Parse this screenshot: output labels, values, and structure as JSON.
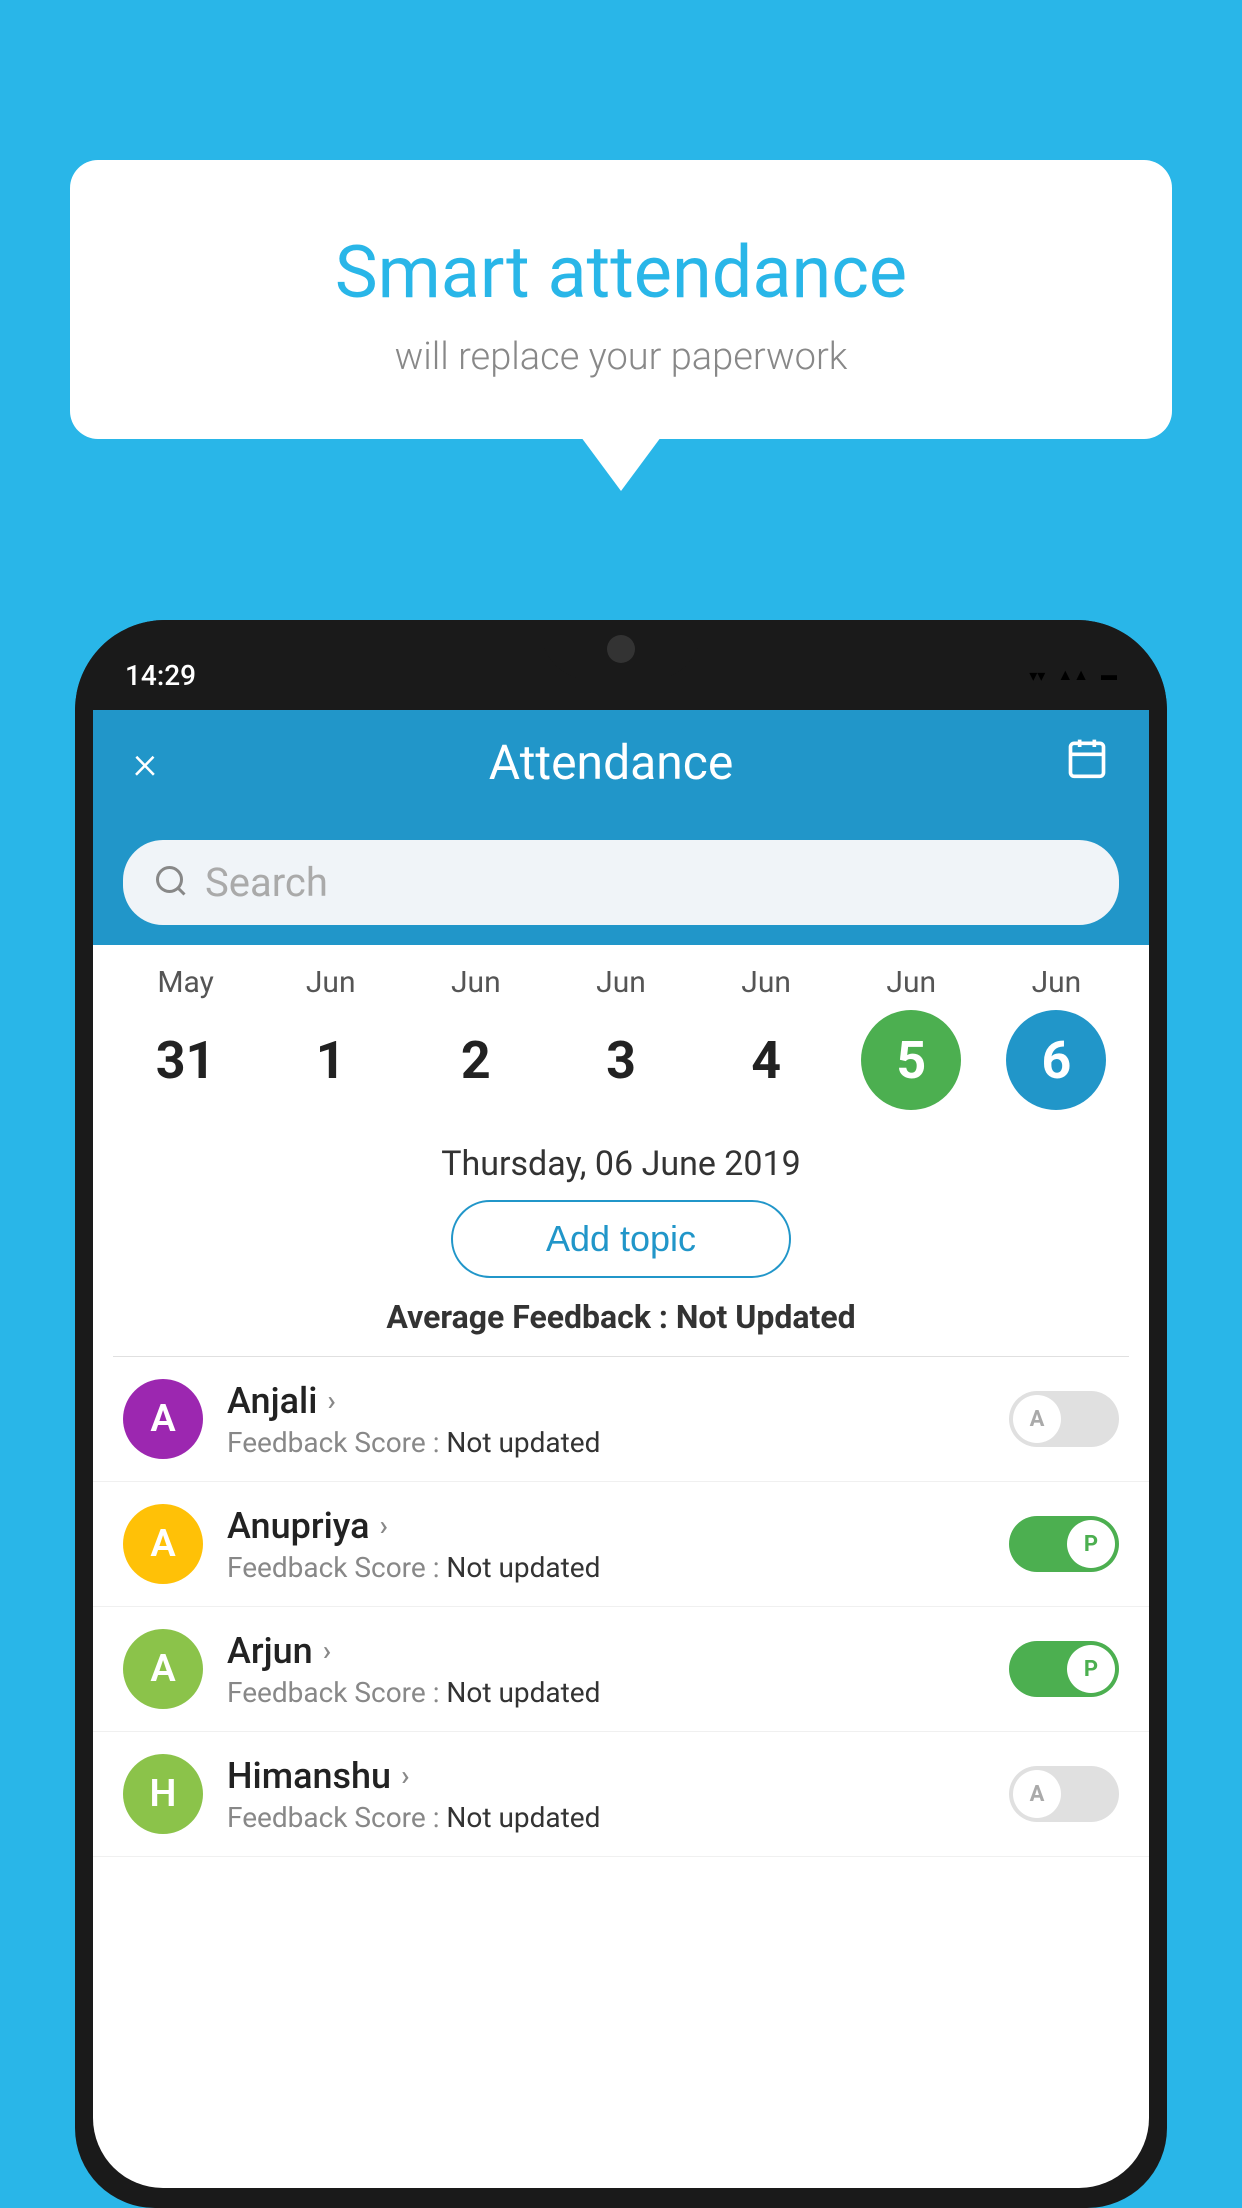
{
  "background_color": "#29B6E8",
  "bubble": {
    "title": "Smart attendance",
    "subtitle": "will replace your paperwork"
  },
  "phone": {
    "status_time": "14:29",
    "header": {
      "title": "Attendance",
      "close_label": "×",
      "calendar_icon": "📅"
    },
    "search": {
      "placeholder": "Search"
    },
    "calendar": {
      "items": [
        {
          "month": "May",
          "day": "31",
          "state": "normal"
        },
        {
          "month": "Jun",
          "day": "1",
          "state": "normal"
        },
        {
          "month": "Jun",
          "day": "2",
          "state": "normal"
        },
        {
          "month": "Jun",
          "day": "3",
          "state": "normal"
        },
        {
          "month": "Jun",
          "day": "4",
          "state": "normal"
        },
        {
          "month": "Jun",
          "day": "5",
          "state": "today"
        },
        {
          "month": "Jun",
          "day": "6",
          "state": "selected"
        }
      ]
    },
    "selected_date": "Thursday, 06 June 2019",
    "add_topic_label": "Add topic",
    "avg_feedback_label": "Average Feedback :",
    "avg_feedback_value": "Not Updated",
    "students": [
      {
        "name": "Anjali",
        "feedback": "Not updated",
        "avatar_letter": "A",
        "avatar_color": "#9C27B0",
        "attendance": "absent"
      },
      {
        "name": "Anupriya",
        "feedback": "Not updated",
        "avatar_letter": "A",
        "avatar_color": "#FFC107",
        "attendance": "present"
      },
      {
        "name": "Arjun",
        "feedback": "Not updated",
        "avatar_letter": "A",
        "avatar_color": "#8BC34A",
        "attendance": "present"
      },
      {
        "name": "Himanshu",
        "feedback": "Not updated",
        "avatar_letter": "H",
        "avatar_color": "#8BC34A",
        "attendance": "absent"
      }
    ]
  }
}
